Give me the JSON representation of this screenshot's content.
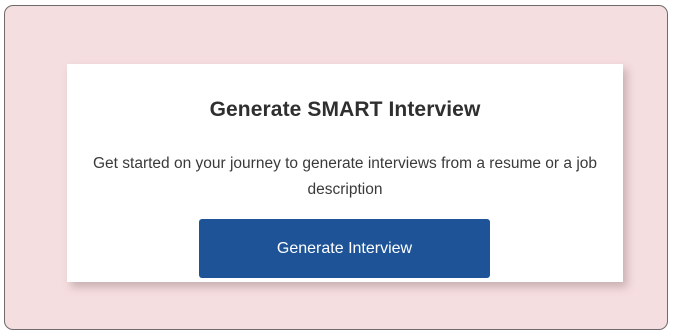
{
  "card": {
    "title": "Generate SMART Interview",
    "description": "Get started on your journey to generate interviews from a resume or a job description",
    "button_label": "Generate Interview"
  },
  "colors": {
    "background": "#f5dedf",
    "button": "#1e5497",
    "card": "#ffffff"
  }
}
